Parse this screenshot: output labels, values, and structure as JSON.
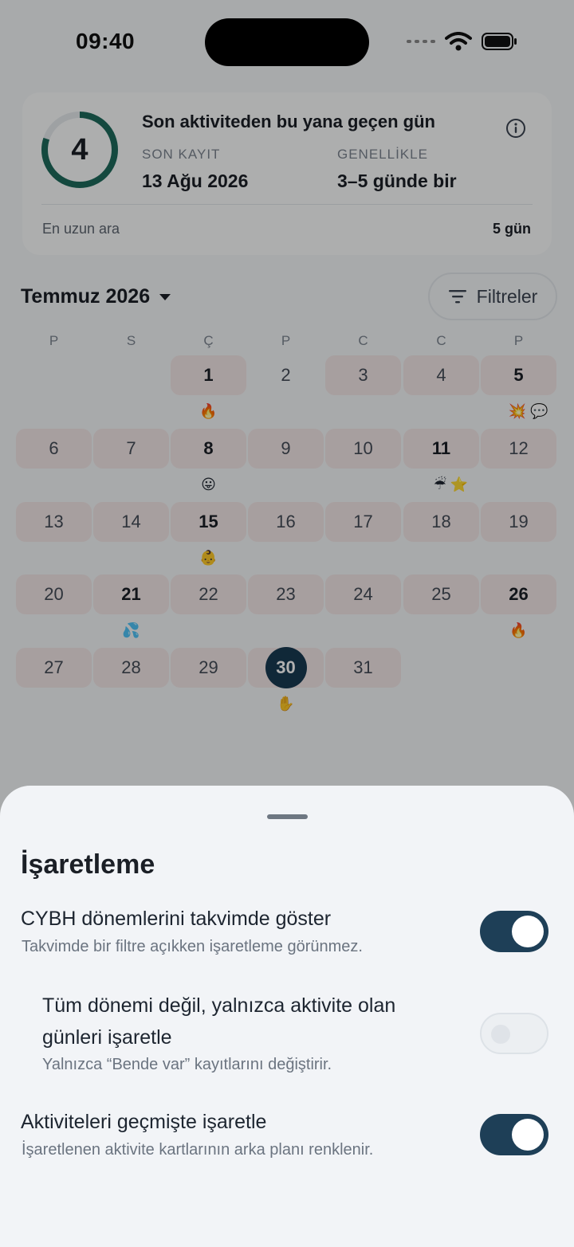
{
  "status": {
    "time": "09:40"
  },
  "summary": {
    "count": "4",
    "progress": 0.8,
    "title": "Son aktiviteden bu yana geçen gün",
    "last_label": "SON KAYIT",
    "last_value": "13 Ağu 2026",
    "usual_label": "GENELLİKLE",
    "usual_value": "3–5 günde bir",
    "longest_label": "En uzun ara",
    "longest_value": "5 gün",
    "ring_color": "#1e6b5c"
  },
  "calendar": {
    "month_label": "Temmuz 2026",
    "filter_label": "Filtreler",
    "weekdays": [
      "P",
      "S",
      "Ç",
      "P",
      "C",
      "C",
      "P"
    ],
    "first_weekday_index": 2,
    "today": 30,
    "days": [
      {
        "d": 1,
        "act": true,
        "bold": true,
        "emoji": "🔥"
      },
      {
        "d": 2,
        "act": false,
        "bold": false,
        "emoji": ""
      },
      {
        "d": 3,
        "act": true,
        "bold": false,
        "emoji": ""
      },
      {
        "d": 4,
        "act": true,
        "bold": false,
        "emoji": ""
      },
      {
        "d": 5,
        "act": true,
        "bold": true,
        "emoji": "💥 💬"
      },
      {
        "d": 6,
        "act": true,
        "bold": false,
        "emoji": ""
      },
      {
        "d": 7,
        "act": true,
        "bold": false,
        "emoji": ""
      },
      {
        "d": 8,
        "act": true,
        "bold": true,
        "emoji": "😛"
      },
      {
        "d": 9,
        "act": true,
        "bold": false,
        "emoji": ""
      },
      {
        "d": 10,
        "act": true,
        "bold": false,
        "emoji": ""
      },
      {
        "d": 11,
        "act": true,
        "bold": true,
        "emoji": "☔ ⭐"
      },
      {
        "d": 12,
        "act": true,
        "bold": false,
        "emoji": ""
      },
      {
        "d": 13,
        "act": true,
        "bold": false,
        "emoji": ""
      },
      {
        "d": 14,
        "act": true,
        "bold": false,
        "emoji": ""
      },
      {
        "d": 15,
        "act": true,
        "bold": true,
        "emoji": "👶"
      },
      {
        "d": 16,
        "act": true,
        "bold": false,
        "emoji": ""
      },
      {
        "d": 17,
        "act": true,
        "bold": false,
        "emoji": ""
      },
      {
        "d": 18,
        "act": true,
        "bold": false,
        "emoji": ""
      },
      {
        "d": 19,
        "act": true,
        "bold": false,
        "emoji": ""
      },
      {
        "d": 20,
        "act": true,
        "bold": false,
        "emoji": ""
      },
      {
        "d": 21,
        "act": true,
        "bold": true,
        "emoji": "💦"
      },
      {
        "d": 22,
        "act": true,
        "bold": false,
        "emoji": ""
      },
      {
        "d": 23,
        "act": true,
        "bold": false,
        "emoji": ""
      },
      {
        "d": 24,
        "act": true,
        "bold": false,
        "emoji": ""
      },
      {
        "d": 25,
        "act": true,
        "bold": false,
        "emoji": ""
      },
      {
        "d": 26,
        "act": true,
        "bold": true,
        "emoji": "🔥"
      },
      {
        "d": 27,
        "act": true,
        "bold": false,
        "emoji": ""
      },
      {
        "d": 28,
        "act": true,
        "bold": false,
        "emoji": ""
      },
      {
        "d": 29,
        "act": true,
        "bold": false,
        "emoji": ""
      },
      {
        "d": 30,
        "act": true,
        "bold": true,
        "emoji": "✋"
      },
      {
        "d": 31,
        "act": true,
        "bold": false,
        "emoji": ""
      }
    ]
  },
  "sheet": {
    "title": "İşaretleme",
    "options": [
      {
        "title": "CYBH dönemlerini takvimde göster",
        "subtitle": "Takvimde bir filtre açıkken işaretleme görünmez.",
        "on": true
      },
      {
        "title": "Tüm dönemi değil, yalnızca aktivite olan günleri işaretle",
        "subtitle": "Yalnızca “Bende var” kayıtlarını değiştirir.",
        "on": false
      },
      {
        "title": "Aktiviteleri geçmişte işaretle",
        "subtitle": "İşaretlenen aktivite kartlarının arka planı renklenir.",
        "on": true
      }
    ]
  }
}
